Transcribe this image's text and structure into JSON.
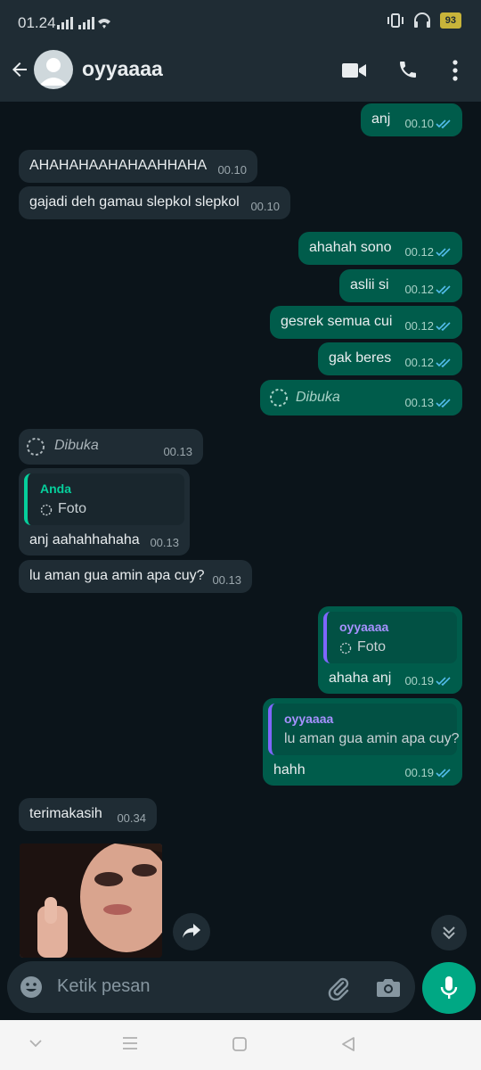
{
  "status": {
    "time": "01.24",
    "battery": "93"
  },
  "header": {
    "contact_name": "oyyaaaa"
  },
  "messages": [
    {
      "text": "anj",
      "time": "00.10"
    },
    {
      "text": "AHAHAHAAHAHAAHHAHA",
      "time": "00.10"
    },
    {
      "text": "gajadi deh gamau slepkol slepkol",
      "time": "00.10"
    },
    {
      "text": "ahahah sono",
      "time": "00.12"
    },
    {
      "text": "aslii si",
      "time": "00.12"
    },
    {
      "text": "gesrek semua cui",
      "time": "00.12"
    },
    {
      "text": "gak beres",
      "time": "00.12"
    },
    {
      "text": "Dibuka",
      "time": "00.13"
    },
    {
      "text": "Dibuka",
      "time": "00.13"
    },
    {
      "quote_name": "Anda",
      "quote_text": "Foto",
      "text": "anj aahahhahaha",
      "time": "00.13"
    },
    {
      "text": "lu aman gua amin apa cuy?",
      "time": "00.13"
    },
    {
      "quote_name": "oyyaaaa",
      "quote_text": "Foto",
      "text": "ahaha anj",
      "time": "00.19"
    },
    {
      "quote_name": "oyyaaaa",
      "quote_text": "lu aman gua amin apa cuy?",
      "text": "hahh",
      "time": "00.19"
    },
    {
      "text": "terimakasih",
      "time": "00.34"
    }
  ],
  "composer": {
    "placeholder": "Ketik pesan"
  },
  "colors": {
    "incoming": "#1f2c34",
    "outgoing": "#005c4b",
    "accent": "#00a884",
    "read_ticks": "#53bdeb"
  }
}
